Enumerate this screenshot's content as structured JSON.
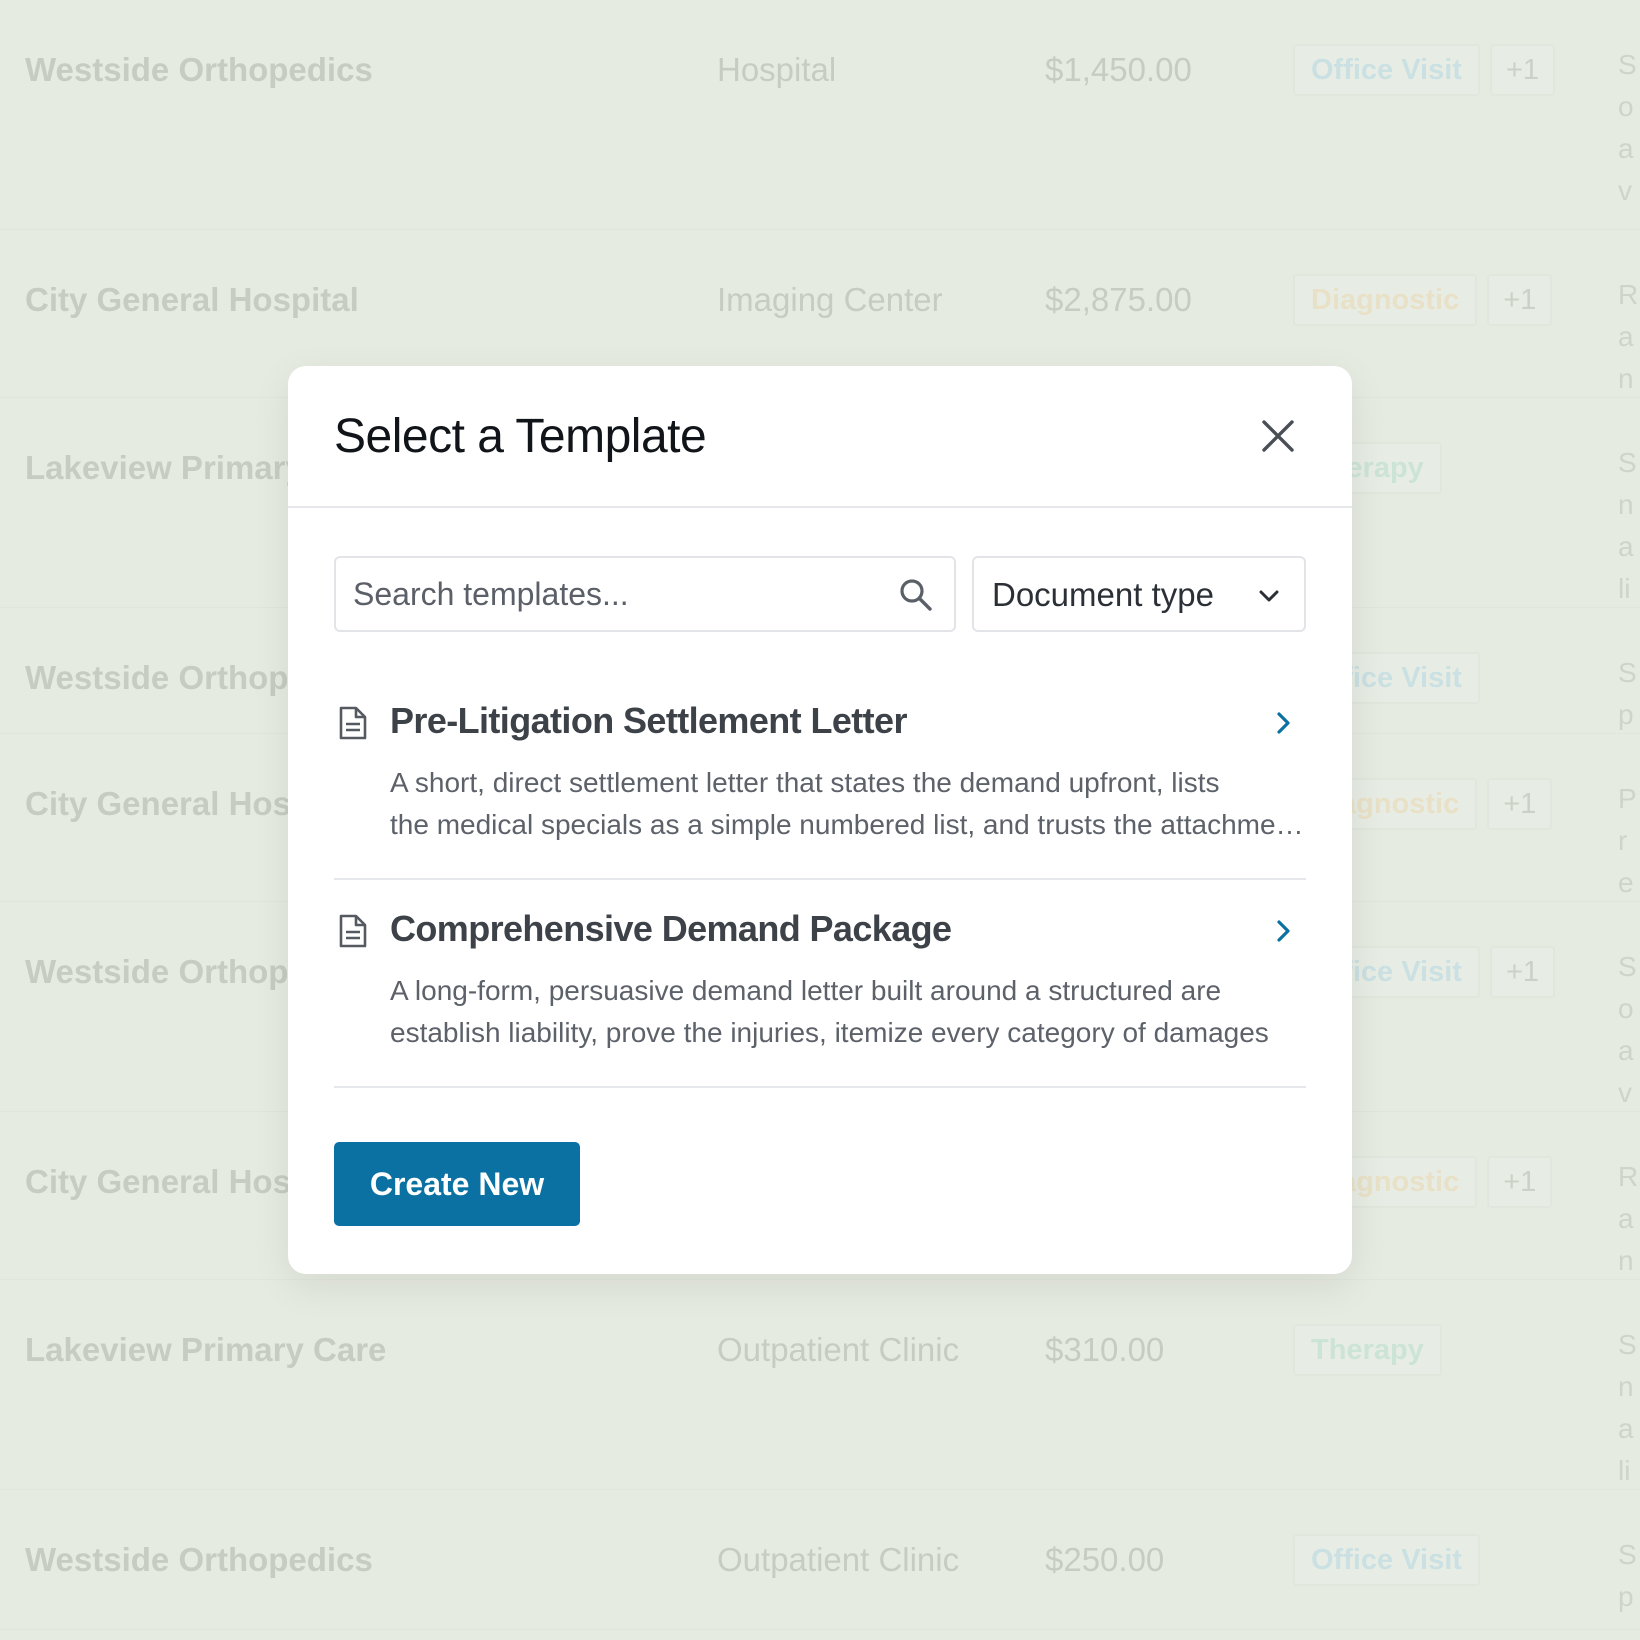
{
  "background_table": {
    "rows": [
      {
        "name": "Westside Orthopedics",
        "type": "Hospital",
        "amount": "$1,450.00",
        "tag": "Office Visit",
        "tag_color": "#bcdbe2",
        "more": "+1",
        "notes": "S o a v",
        "height": 230
      },
      {
        "name": "City General Hospital",
        "type": "Imaging Center",
        "amount": "$2,875.00",
        "tag": "Diagnostic",
        "tag_color": "#ecdcb8",
        "more": "+1",
        "notes": "R a n",
        "height": 168
      },
      {
        "name": "Lakeview Primary Care",
        "type": "",
        "amount": "",
        "tag": "Therapy",
        "tag_color": "#bfe0cf",
        "more": "",
        "notes": "S n a li",
        "height": 210
      },
      {
        "name": "Westside Orthopedics",
        "type": "",
        "amount": "",
        "tag": "Office Visit",
        "tag_color": "#bcdbe2",
        "more": "",
        "notes": "S p",
        "height": 126
      },
      {
        "name": "City General Hospital",
        "type": "",
        "amount": "",
        "tag": "Diagnostic",
        "tag_color": "#ecdcb8",
        "more": "+1",
        "notes": "P r e",
        "height": 168
      },
      {
        "name": "Westside Orthopedics",
        "type": "",
        "amount": "",
        "tag": "Office Visit",
        "tag_color": "#bcdbe2",
        "more": "+1",
        "notes": "S o a v",
        "height": 210
      },
      {
        "name": "City General Hospital",
        "type": "",
        "amount": "",
        "tag": "Diagnostic",
        "tag_color": "#ecdcb8",
        "more": "+1",
        "notes": "R a n",
        "height": 168
      },
      {
        "name": "Lakeview Primary Care",
        "type": "Outpatient Clinic",
        "amount": "$310.00",
        "tag": "Therapy",
        "tag_color": "#bfe0cf",
        "more": "",
        "notes": "S n a li",
        "height": 210
      },
      {
        "name": "Westside Orthopedics",
        "type": "Outpatient Clinic",
        "amount": "$250.00",
        "tag": "Office Visit",
        "tag_color": "#bcdbe2",
        "more": "",
        "notes": "S p",
        "height": 140
      }
    ]
  },
  "modal": {
    "title": "Select a Template",
    "search_placeholder": "Search templates...",
    "document_type_label": "Document type",
    "templates": [
      {
        "title": "Pre-Litigation Settlement Letter",
        "desc_line1": "A short, direct settlement letter that states the demand upfront, lists",
        "desc_line2": "the medical specials as a simple numbered list, and trusts the attachments to speak for themselves"
      },
      {
        "title": "Comprehensive Demand Package",
        "desc_line1": "A long-form, persuasive demand letter built around a structured are",
        "desc_line2": "establish liability, prove the injuries, itemize every category of damages"
      }
    ],
    "create_label": "Create New"
  },
  "colors": {
    "accent": "#0b71a2",
    "chevron": "#0b71a2",
    "background": "#e6ebe1"
  }
}
